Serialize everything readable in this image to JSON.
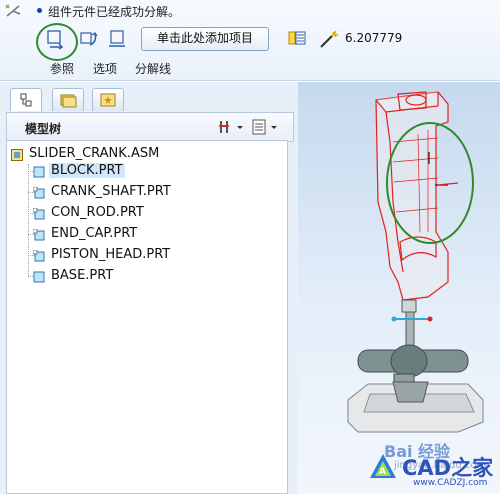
{
  "status": {
    "message": "组件元件已经成功分解。"
  },
  "toolbar": {
    "collect_button": "单击此处添加项目",
    "value": "6.207779",
    "tabs": [
      "参照",
      "选项",
      "分解线"
    ]
  },
  "panel": {
    "tree_title": "模型树"
  },
  "tree": {
    "root": "SLIDER_CRANK.ASM",
    "items": [
      "BLOCK.PRT",
      "CRANK_SHAFT.PRT",
      "CON_ROD.PRT",
      "END_CAP.PRT",
      "PISTON_HEAD.PRT",
      "BASE.PRT"
    ]
  },
  "watermark": {
    "baidu": "Bai 经验",
    "baidu_url": "jingyan.baidu.com",
    "site": "CAD之家",
    "site_url": "www.CADZJ.com"
  },
  "colors": {
    "accent_circle": "#2c8b2c",
    "wire_red": "#e02020",
    "selected_row": "#cfe6fb"
  }
}
